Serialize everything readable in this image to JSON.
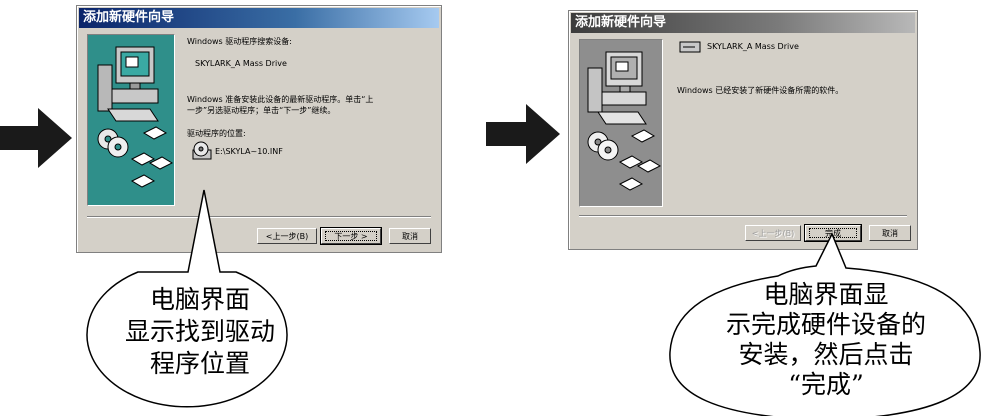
{
  "left_window": {
    "title": "添加新硬件向导",
    "heading": "Windows 驱动程序搜索设备:",
    "device_name": "SKYLARK_A Mass Drive",
    "message_line1": "Windows 准备安装此设备的最新驱动程序。单击“上",
    "message_line2": "一步”另选驱动程序；单击“下一步”继续。",
    "location_label": "驱动程序的位置:",
    "driver_path": "E:\\SKYLA~10.INF",
    "back_button": "<上一步(B)",
    "next_button": "下一步 >",
    "cancel_button": "取消"
  },
  "right_window": {
    "title": "添加新硬件向导",
    "device_name": "SKYLARK_A Mass Drive",
    "message": "Windows 已经安装了新硬件设备所需的软件。",
    "back_button": "<上一步(B)",
    "finish_button": "完成",
    "cancel_button": "取消"
  },
  "callouts": {
    "left": [
      "电脑界面",
      "显示找到驱动",
      "程序位置"
    ],
    "right": [
      "电脑界面显",
      "示完成硬件设备的",
      "安装，然后点击",
      "“完成”"
    ]
  },
  "colors": {
    "titlebar_active": "#0a246a",
    "titlebar_inactive": "#3c3c3c",
    "dialog_bg": "#d4d0c8",
    "side_panel_teal": "#008080"
  }
}
